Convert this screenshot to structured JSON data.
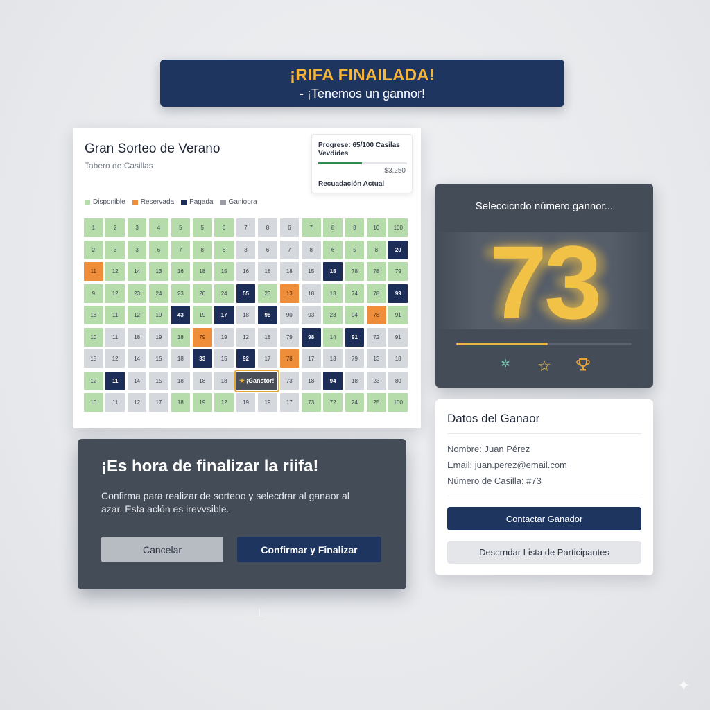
{
  "banner": {
    "title": "¡RIFA FINAILADA!",
    "subtitle": "- ¡Tenemos un gannor!"
  },
  "board": {
    "title": "Gran Sorteo de Verano",
    "subtitle": "Tabero de Casillas",
    "progress": {
      "label": "Progrese: 65/100 Casilas Vevdides",
      "fraction": 0.49,
      "amount": "$3,250",
      "caption": "Recuadación Actual"
    },
    "legend": [
      {
        "label": "Disponible",
        "color": "#b7dcab"
      },
      {
        "label": "Reservada",
        "color": "#ef8e3a"
      },
      {
        "label": "Pagada",
        "color": "#1c2d57"
      },
      {
        "label": "Ganioora",
        "color": "#9a9ea4"
      }
    ],
    "winner_label": "¡Ganstor!",
    "grid": [
      [
        [
          "1",
          "avail"
        ],
        [
          "2",
          "avail"
        ],
        [
          "3",
          "avail"
        ],
        [
          "4",
          "avail"
        ],
        [
          "5",
          "avail"
        ],
        [
          "5",
          "avail"
        ],
        [
          "6",
          "avail"
        ],
        [
          "7",
          "gray"
        ],
        [
          "8",
          "gray"
        ],
        [
          "6",
          "gray"
        ],
        [
          "7",
          "avail"
        ],
        [
          "8",
          "avail"
        ],
        [
          "8",
          "avail"
        ],
        [
          "10",
          "avail"
        ],
        [
          "100",
          "avail"
        ]
      ],
      [
        [
          "2",
          "avail"
        ],
        [
          "3",
          "avail"
        ],
        [
          "3",
          "avail"
        ],
        [
          "6",
          "avail"
        ],
        [
          "7",
          "avail"
        ],
        [
          "8",
          "avail"
        ],
        [
          "8",
          "avail"
        ],
        [
          "8",
          "gray"
        ],
        [
          "6",
          "gray"
        ],
        [
          "7",
          "gray"
        ],
        [
          "8",
          "gray"
        ],
        [
          "6",
          "avail"
        ],
        [
          "5",
          "avail"
        ],
        [
          "8",
          "avail"
        ],
        [
          "20",
          "paid"
        ]
      ],
      [
        [
          "11",
          "res"
        ],
        [
          "12",
          "avail"
        ],
        [
          "14",
          "avail"
        ],
        [
          "13",
          "avail"
        ],
        [
          "16",
          "avail"
        ],
        [
          "18",
          "avail"
        ],
        [
          "15",
          "avail"
        ],
        [
          "16",
          "gray"
        ],
        [
          "18",
          "gray"
        ],
        [
          "18",
          "gray"
        ],
        [
          "15",
          "gray"
        ],
        [
          "18",
          "paid"
        ],
        [
          "78",
          "avail"
        ],
        [
          "78",
          "avail"
        ],
        [
          "79",
          "avail"
        ]
      ],
      [
        [
          "9",
          "avail"
        ],
        [
          "12",
          "avail"
        ],
        [
          "23",
          "avail"
        ],
        [
          "24",
          "avail"
        ],
        [
          "23",
          "avail"
        ],
        [
          "20",
          "avail"
        ],
        [
          "24",
          "avail"
        ],
        [
          "55",
          "paid"
        ],
        [
          "23",
          "avail"
        ],
        [
          "13",
          "res"
        ],
        [
          "18",
          "gray"
        ],
        [
          "13",
          "avail"
        ],
        [
          "74",
          "avail"
        ],
        [
          "78",
          "avail"
        ],
        [
          "99",
          "paid"
        ]
      ],
      [
        [
          "18",
          "avail"
        ],
        [
          "11",
          "avail"
        ],
        [
          "12",
          "avail"
        ],
        [
          "19",
          "avail"
        ],
        [
          "43",
          "paid"
        ],
        [
          "19",
          "avail"
        ],
        [
          "17",
          "paid"
        ],
        [
          "18",
          "gray"
        ],
        [
          "98",
          "paid"
        ],
        [
          "90",
          "gray"
        ],
        [
          "93",
          "gray"
        ],
        [
          "23",
          "avail"
        ],
        [
          "94",
          "avail"
        ],
        [
          "78",
          "res"
        ],
        [
          "91",
          "avail"
        ]
      ],
      [
        [
          "10",
          "avail"
        ],
        [
          "11",
          "gray"
        ],
        [
          "18",
          "gray"
        ],
        [
          "19",
          "gray"
        ],
        [
          "18",
          "avail"
        ],
        [
          "79",
          "res"
        ],
        [
          "19",
          "gray"
        ],
        [
          "12",
          "gray"
        ],
        [
          "18",
          "gray"
        ],
        [
          "79",
          "gray"
        ],
        [
          "98",
          "paid"
        ],
        [
          "14",
          "avail"
        ],
        [
          "91",
          "paid"
        ],
        [
          "72",
          "gray"
        ],
        [
          "91",
          "gray"
        ]
      ],
      [
        [
          "18",
          "gray"
        ],
        [
          "12",
          "gray"
        ],
        [
          "14",
          "gray"
        ],
        [
          "15",
          "gray"
        ],
        [
          "18",
          "gray"
        ],
        [
          "33",
          "paid"
        ],
        [
          "15",
          "gray"
        ],
        [
          "92",
          "paid"
        ],
        [
          "17",
          "gray"
        ],
        [
          "78",
          "res"
        ],
        [
          "17",
          "gray"
        ],
        [
          "13",
          "gray"
        ],
        [
          "79",
          "gray"
        ],
        [
          "13",
          "gray"
        ],
        [
          "18",
          "gray"
        ]
      ],
      [
        [
          "12",
          "avail"
        ],
        [
          "11",
          "paid"
        ],
        [
          "14",
          "gray"
        ],
        [
          "15",
          "gray"
        ],
        [
          "18",
          "gray"
        ],
        [
          "18",
          "gray"
        ],
        [
          "18",
          "gray"
        ],
        [
          "WIN",
          "win"
        ],
        [
          "WIN",
          "skip"
        ],
        [
          "73",
          "gray"
        ],
        [
          "18",
          "gray"
        ],
        [
          "94",
          "paid"
        ],
        [
          "18",
          "gray"
        ],
        [
          "23",
          "gray"
        ],
        [
          "80",
          "gray"
        ]
      ],
      [
        [
          "10",
          "avail"
        ],
        [
          "11",
          "gray"
        ],
        [
          "12",
          "gray"
        ],
        [
          "17",
          "gray"
        ],
        [
          "18",
          "avail"
        ],
        [
          "19",
          "avail"
        ],
        [
          "12",
          "avail"
        ],
        [
          "19",
          "gray"
        ],
        [
          "19",
          "gray"
        ],
        [
          "17",
          "gray"
        ],
        [
          "73",
          "avail"
        ],
        [
          "72",
          "avail"
        ],
        [
          "24",
          "avail"
        ],
        [
          "25",
          "avail"
        ],
        [
          "100",
          "avail"
        ]
      ]
    ]
  },
  "picker": {
    "title": "Seleccicndo número gannor...",
    "number": "73",
    "progress_fraction": 0.52,
    "icons": [
      "confetti-icon",
      "star-icon",
      "trophy-icon"
    ]
  },
  "winner": {
    "title": "Datos del Ganaor",
    "name": "Nombre: Juan Pérez",
    "email": "Email: juan.perez@email.com",
    "cell": "Número de Casilla: #73",
    "contact_label": "Contactar Ganador",
    "download_label": "Descrndar Lista de Participantes"
  },
  "dialog": {
    "title": "¡Es hora de finalizar la riifa!",
    "body": "Confirma para realizar de sorteoo y selecdrar al ganaor al azar. Esta aclón es irevvsible.",
    "cancel_label": "Cancelar",
    "confirm_label": "Confirmar y Finalizar"
  }
}
